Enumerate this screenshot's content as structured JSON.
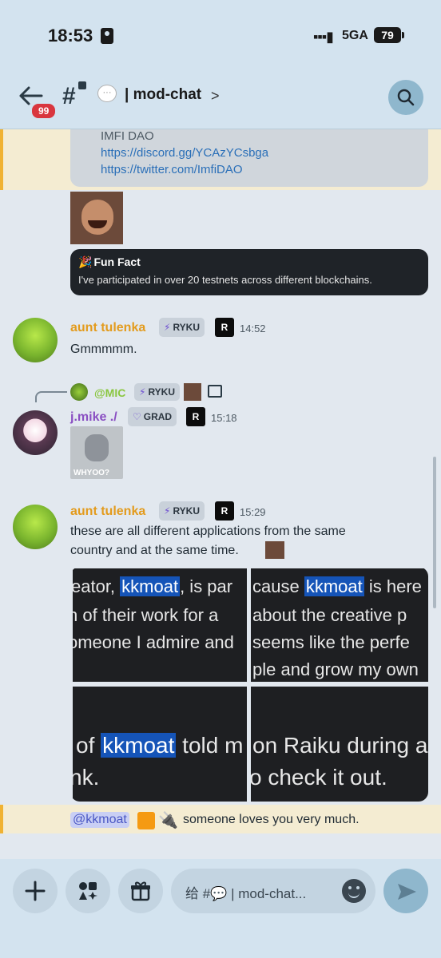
{
  "status": {
    "time": "18:53",
    "network": "5GA",
    "battery": "79"
  },
  "header": {
    "back_badge": "99",
    "channel": "| mod-chat",
    "chevron": ">"
  },
  "embed": {
    "title": "IMFI DAO",
    "links": [
      "https://discord.gg/YCAzYCsbga",
      "https://twitter.com/ImfiDAO"
    ]
  },
  "funfact": {
    "title": "Fun Fact",
    "body": "I've participated in over 20 testnets across different blockchains."
  },
  "messages": [
    {
      "user": "aunt tulenka",
      "tag": "RYKU",
      "time": "14:52",
      "text": "Gmmmmm."
    },
    {
      "reply_to": "@MIC",
      "reply_tag": "RYKU",
      "user": "j.mike ./",
      "tag": "GRAD",
      "time": "15:18"
    },
    {
      "user": "aunt tulenka",
      "tag": "RYKU",
      "time": "15:29",
      "text1": "these are all different applications from the same",
      "text2": "country and at the same time."
    }
  ],
  "grid": {
    "c1": [
      "eator, ",
      "kkmoat",
      ", is par",
      "n of their work for a",
      "omeone I admire and"
    ],
    "c2": [
      "cause ",
      "kkmoat",
      " is here",
      "about the creative p",
      "seems like the perfe",
      "ple and grow my own"
    ],
    "c3": [
      "of ",
      "kkmoat",
      " told m",
      "nk."
    ],
    "c4": [
      "on Raiku during a",
      "o check it out."
    ]
  },
  "mention": {
    "who": "@kkmoat",
    "text": "someone loves you very much."
  },
  "composer": {
    "placeholder": "给 #💬 | mod-chat..."
  },
  "badge_letter": "R"
}
